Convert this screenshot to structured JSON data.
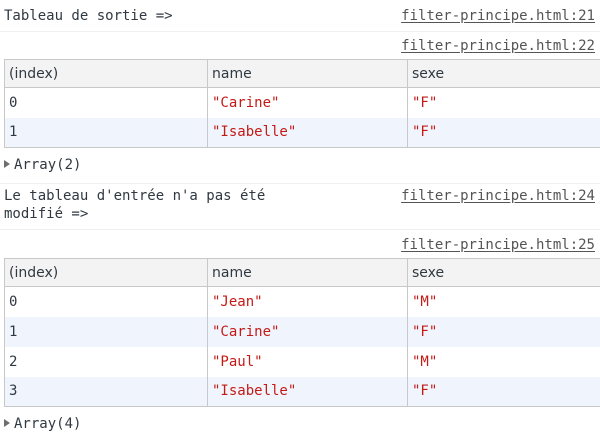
{
  "messages": {
    "m1": {
      "text": "Tableau de sortie =>",
      "source": "filter-principe.html:21"
    },
    "m2": {
      "source": "filter-principe.html:22",
      "columns": [
        "(index)",
        "name",
        "sexe"
      ],
      "rows": [
        [
          "0",
          "\"Carine\"",
          "\"F\""
        ],
        [
          "1",
          "\"Isabelle\"",
          "\"F\""
        ]
      ],
      "summary": "Array(2)"
    },
    "m3": {
      "text": "Le tableau d'entrée n'a pas été\nmodifié =>",
      "source": "filter-principe.html:24"
    },
    "m4": {
      "source": "filter-principe.html:25",
      "columns": [
        "(index)",
        "name",
        "sexe"
      ],
      "rows": [
        [
          "0",
          "\"Jean\"",
          "\"M\""
        ],
        [
          "1",
          "\"Carine\"",
          "\"F\""
        ],
        [
          "2",
          "\"Paul\"",
          "\"M\""
        ],
        [
          "3",
          "\"Isabelle\"",
          "\"F\""
        ]
      ],
      "summary": "Array(4)"
    }
  },
  "colors": {
    "string_value": "#c41a16",
    "header_bg": "#f3f3f3",
    "alt_row_bg": "#f0f5fd",
    "text": "#303942"
  },
  "icons": {
    "expand": "triangle-right-icon"
  }
}
